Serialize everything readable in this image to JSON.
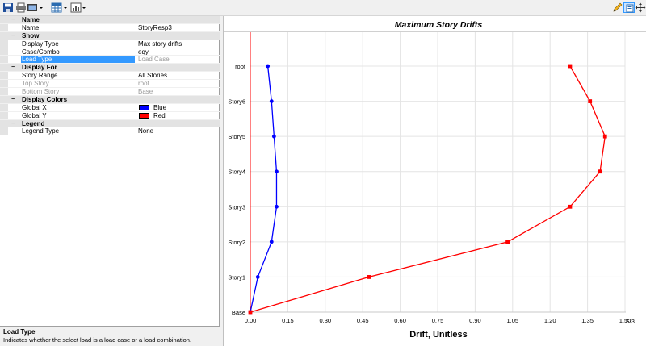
{
  "toolbar": {
    "buttons": [
      {
        "name": "save-icon",
        "color": "#1f4e9a"
      },
      {
        "name": "print-icon",
        "color": "#4a4a4a"
      },
      {
        "name": "screenshot-icon",
        "color": "#4a4a4a"
      },
      {
        "name": "table-icon",
        "color": "#2b6cb0"
      },
      {
        "name": "chart-icon",
        "color": "#4a4a4a"
      }
    ],
    "right_buttons": [
      {
        "name": "pencil-icon"
      },
      {
        "name": "properties-icon"
      },
      {
        "name": "move-icon"
      }
    ]
  },
  "properties": {
    "name_section": {
      "title": "Name",
      "name_label": "Name",
      "name_value": "StoryResp3"
    },
    "show_section": {
      "title": "Show",
      "display_type_label": "Display Type",
      "display_type_value": "Max story drifts",
      "case_label": "Case/Combo",
      "case_value": "eqy",
      "load_type_label": "Load Type",
      "load_type_value": "Load Case"
    },
    "display_for_section": {
      "title": "Display For",
      "story_range_label": "Story Range",
      "story_range_value": "All Stories",
      "top_story_label": "Top Story",
      "top_story_value": "roof",
      "bottom_story_label": "Bottom Story",
      "bottom_story_value": "Base"
    },
    "colors_section": {
      "title": "Display Colors",
      "global_x_label": "Global X",
      "global_x_value": "Blue",
      "global_x_color": "#0000ff",
      "global_y_label": "Global Y",
      "global_y_value": "Red",
      "global_y_color": "#ff0000"
    },
    "legend_section": {
      "title": "Legend",
      "legend_type_label": "Legend Type",
      "legend_type_value": "None"
    },
    "toggle_glyph": "−"
  },
  "help": {
    "title": "Load Type",
    "text": "Indicates whether the select load is a load case or a load combination."
  },
  "chart_data": {
    "type": "line",
    "title": "Maximum Story Drifts",
    "xlabel": "Drift, Unitless",
    "x_multiplier_label": "E-3",
    "xlim": [
      0,
      1.5
    ],
    "x_ticks": [
      "0.00",
      "0.15",
      "0.30",
      "0.45",
      "0.60",
      "0.75",
      "0.90",
      "1.05",
      "1.20",
      "1.35",
      "1.50"
    ],
    "stories": [
      "Base",
      "Story1",
      "Story2",
      "Story3",
      "Story4",
      "Story5",
      "Story6",
      "roof"
    ],
    "grid": true,
    "series": [
      {
        "name": "Global X",
        "color": "#0000ff",
        "marker": "circle",
        "values": [
          0.0,
          0.03,
          0.085,
          0.105,
          0.105,
          0.095,
          0.085,
          0.07
        ]
      },
      {
        "name": "Global Y",
        "color": "#ff0000",
        "marker": "square",
        "values": [
          0.0,
          0.475,
          1.03,
          1.28,
          1.4,
          1.42,
          1.36,
          1.28
        ]
      }
    ]
  }
}
